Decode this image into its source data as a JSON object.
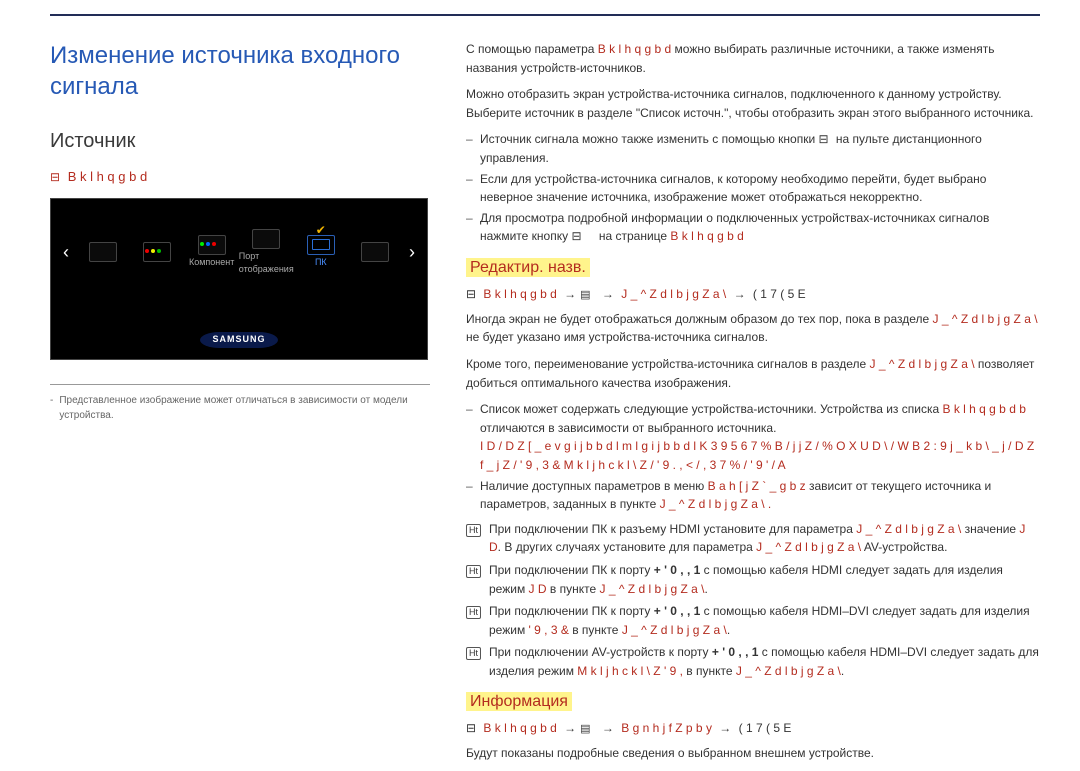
{
  "left": {
    "title": "Изменение источника входного сигнала",
    "sub": "Источник",
    "path": "B k l h q g b d",
    "shot": {
      "src1": "",
      "src2": "",
      "src3": "Компонент",
      "src4": "Порт отображения",
      "src5": "ПК",
      "src6": "",
      "logo": "SAMSUNG"
    },
    "caption": "Представленное изображение может отличаться в зависимости от модели устройства."
  },
  "right": {
    "p1a": "С помощью параметра",
    "p1key": "B k l h q g b d",
    "p1b": "можно выбирать различные источники, а также изменять названия устройств-источников.",
    "p2": "Можно отобразить экран устройства-источника сигналов, подключенного к данному устройству. Выберите источник в разделе \"Список источн.\", чтобы отобразить экран этого выбранного источника.",
    "d1": "Источник сигнала можно также изменить с помощью кнопки",
    "d1b": "на пульте дистанционного управления.",
    "d2": "Если для устройства-источника сигналов, к которому необходимо перейти, будет выбрано неверное значение источника, изображение может отображаться некорректно.",
    "d3a": "Для просмотра подробной информации о подключенных устройствах-источниках сигналов нажмите кнопку",
    "d3b": "на странице",
    "d3key": "B k l h q g b d",
    "editName": {
      "title": "Редактир. назв.",
      "nav1": "B k l h q g b d",
      "nav2": "J _ ^ Z d l b j   g Z a \\",
      "nav3": "( 1 7 ( 5 E",
      "p1a": "Иногда экран не будет отображаться должным образом до тех пор, пока в разделе",
      "p1key": "J _ ^ Z d l b j   g Z a \\",
      "p1b": "не будет указано имя устройства-источника сигналов.",
      "p2a": "Кроме того, переименование устройства-источника сигналов в разделе",
      "p2key": "J _ ^ Z d l b j   g Z a \\",
      "p2b": "позволяет добиться оптимального качества изображения.",
      "d1a": "Список может содержать следующие устройства-источники. Устройства из списка",
      "d1key": "B k l h q g b d b",
      "d1b": "отличаются в зависимости от выбранного источника.",
      "d1line2": "I D  /  D Z [ _ e v g   i j b b d l m l g   i j b b d l K 3 9 5   6 7 % B  /  j j Z  /  % O X   U D \\  /  W B 2  :  9   j _ k b \\ _ j  /  D Z f _ j Z  / ' 9 ,   3   & M k l j h c k l \\ Z   / ' 9 .  ,  <  /  ,  3   7 %  /  '  9  '  /  A",
      "d2a": "Наличие доступных параметров в меню",
      "d2key": "B a h [ j Z ` _ g b z",
      "d2b": "зависит от текущего источника и параметров, заданных в пункте",
      "d2key2": "J _ ^ Z d l b j   g Z a \\ ."
    },
    "tagHt": "Ht",
    "notes": {
      "n1a": "При подключении ПК к разъему HDMI установите для параметра",
      "n1key": "J _ ^ Z d l b j   g Z a \\",
      "n1b": "значение",
      "n1key2": "J D",
      "n1c": "В других случаях установите для параметра",
      "n1key3": "J _ ^ Z d l b j   g Z a \\",
      "n1d": "AV-устройства.",
      "n2a": "При подключении ПК к порту",
      "n2port": "+ ' 0 ,   ,  1",
      "n2b": "с помощью кабеля HDMI следует задать для изделия режим",
      "n2key": "J D",
      "n2c": "в пункте",
      "n2key2": "J _ ^ Z d l b j   g Z a \\",
      "n3a": "При подключении ПК к порту",
      "n3port": "+ ' 0 ,   ,  1",
      "n3b": "с помощью кабеля HDMI–DVI следует задать для изделия режим",
      "n3key": "' 9 ,   3   &",
      "n3c": "в пункте",
      "n3key2": "J _ ^ Z d l b j   g Z a \\",
      "n4a": "При подключении AV-устройств к порту",
      "n4port": "+ ' 0 ,   ,  1",
      "n4b": "с помощью кабеля HDMI–DVI следует задать для изделия режим",
      "n4key": "M k l j h c k l \\ Z   ' 9 ,",
      "n4c": "в пункте",
      "n4key2": "J _ ^ Z d l b j   g Z a \\"
    },
    "info": {
      "title": "Информация",
      "nav1": "B k l h q g b d",
      "nav2": "B g n h j f Z p b y",
      "nav3": "( 1 7 ( 5 E",
      "text": "Будут показаны подробные сведения о выбранном внешнем устройстве."
    }
  }
}
